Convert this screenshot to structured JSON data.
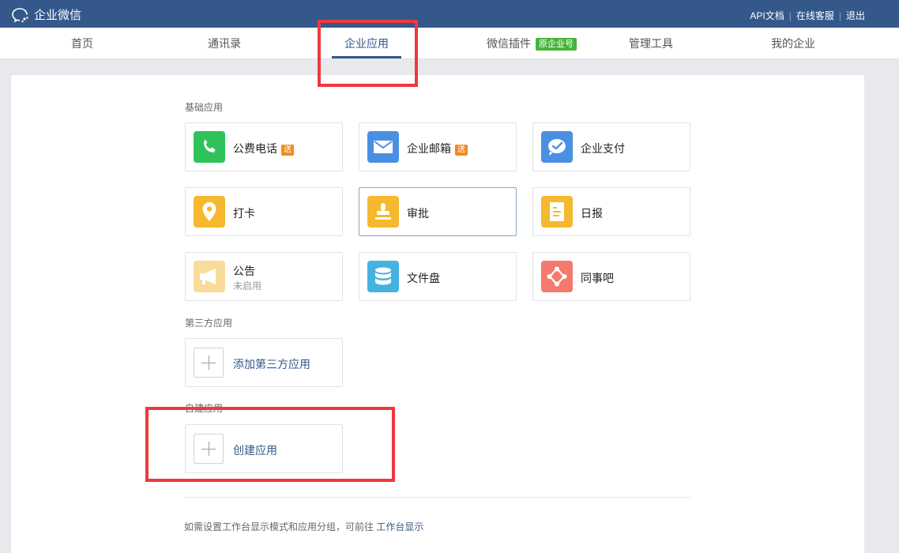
{
  "topbar": {
    "brand": "企业微信",
    "links": [
      "API文档",
      "在线客服",
      "退出"
    ]
  },
  "nav": {
    "items": [
      {
        "label": "首页"
      },
      {
        "label": "通讯录"
      },
      {
        "label": "企业应用",
        "active": true
      },
      {
        "label": "微信插件",
        "badge": "原企业号"
      },
      {
        "label": "管理工具"
      },
      {
        "label": "我的企业"
      }
    ]
  },
  "sections": {
    "basic": "基础应用",
    "third_party": "第三方应用",
    "custom": "自建应用"
  },
  "apps": [
    {
      "name": "公费电话",
      "badge": "送",
      "icon": "phone-icon",
      "color": "#2fc25b"
    },
    {
      "name": "企业邮箱",
      "badge": "送",
      "icon": "mail-icon",
      "color": "#4a90e2"
    },
    {
      "name": "企业支付",
      "icon": "pay-icon",
      "color": "#4a90e2"
    },
    {
      "name": "打卡",
      "icon": "location-pin-icon",
      "color": "#f5b82e"
    },
    {
      "name": "审批",
      "icon": "stamp-icon",
      "color": "#f5b82e"
    },
    {
      "name": "日报",
      "icon": "report-icon",
      "color": "#f5b82e"
    },
    {
      "name": "公告",
      "sub": "未启用",
      "icon": "megaphone-icon",
      "color": "#f9dc99"
    },
    {
      "name": "文件盘",
      "icon": "database-icon",
      "color": "#46b2e0"
    },
    {
      "name": "同事吧",
      "icon": "network-icon",
      "color": "#f57a6e"
    }
  ],
  "add_third_party": "添加第三方应用",
  "create_app": "创建应用",
  "footer": {
    "text": "如需设置工作台显示模式和应用分组，可前往 ",
    "link": "工作台显示"
  }
}
